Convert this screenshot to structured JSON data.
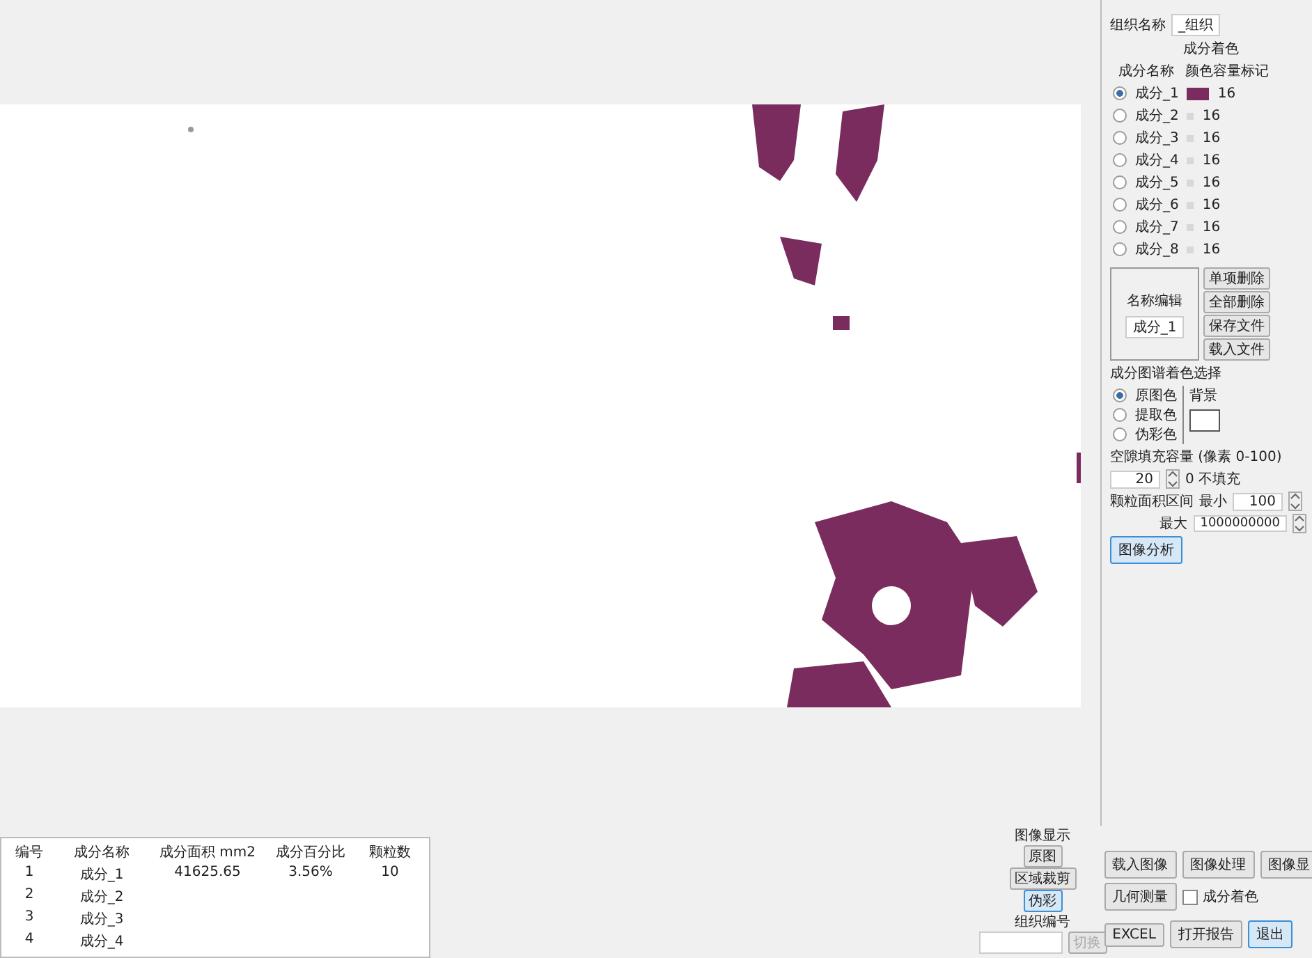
{
  "organization": {
    "label": "组织名称",
    "value": "_组织"
  },
  "component_colors": {
    "title": "成分着色",
    "columns": [
      "成分名称",
      "颜色容量标记"
    ],
    "rows": [
      {
        "name": "成分_1",
        "selected": true,
        "color": "#7a2c5e",
        "value": "16"
      },
      {
        "name": "成分_2",
        "selected": false,
        "color": "#d8d8d8",
        "value": "16"
      },
      {
        "name": "成分_3",
        "selected": false,
        "color": "#d8d8d8",
        "value": "16"
      },
      {
        "name": "成分_4",
        "selected": false,
        "color": "#d8d8d8",
        "value": "16"
      },
      {
        "name": "成分_5",
        "selected": false,
        "color": "#d8d8d8",
        "value": "16"
      },
      {
        "name": "成分_6",
        "selected": false,
        "color": "#d8d8d8",
        "value": "16"
      },
      {
        "name": "成分_7",
        "selected": false,
        "color": "#d8d8d8",
        "value": "16"
      },
      {
        "name": "成分_8",
        "selected": false,
        "color": "#d8d8d8",
        "value": "16"
      }
    ]
  },
  "name_edit": {
    "label": "名称编辑",
    "value": "成分_1",
    "buttons": [
      "单项删除",
      "全部删除",
      "保存文件",
      "载入文件"
    ]
  },
  "coloring": {
    "title": "成分图谱着色选择",
    "options": [
      {
        "label": "原图色",
        "selected": true
      },
      {
        "label": "提取色",
        "selected": false
      },
      {
        "label": "伪彩色",
        "selected": false
      }
    ],
    "background_label": "背景"
  },
  "gap_fill": {
    "label": "空隙填充容量 (像素 0-100)",
    "value": "20",
    "note": "0 不填充"
  },
  "particle_area": {
    "label": "颗粒面积区间",
    "min_label": "最小",
    "min": "100",
    "max_label": "最大",
    "max": "1000000000"
  },
  "analyze_button": "图像分析",
  "results_table": {
    "columns": [
      "编号",
      "成分名称",
      "成分面积 mm2",
      "成分百分比",
      "颗粒数"
    ],
    "rows": [
      [
        "1",
        "成分_1",
        "41625.65",
        "3.56%",
        "10"
      ],
      [
        "2",
        "成分_2"
      ],
      [
        "3",
        "成分_3"
      ],
      [
        "4",
        "成分_4"
      ]
    ]
  },
  "image_display": {
    "title": "图像显示",
    "buttons": [
      {
        "label": "原图",
        "selected": false
      },
      {
        "label": "区域裁剪",
        "selected": false
      },
      {
        "label": "伪彩",
        "selected": true
      }
    ]
  },
  "actions": [
    "载入图像",
    "图像处理",
    "图像显"
  ],
  "measure_button": "几何测量",
  "component_coloring": {
    "label": "成分着色",
    "checked": false
  },
  "org_number": {
    "label": "组织编号",
    "button": "切换"
  },
  "bottom_buttons": [
    {
      "label": "EXCEL",
      "selected": false
    },
    {
      "label": "打开报告",
      "selected": false
    },
    {
      "label": "退出",
      "selected": true
    }
  ]
}
